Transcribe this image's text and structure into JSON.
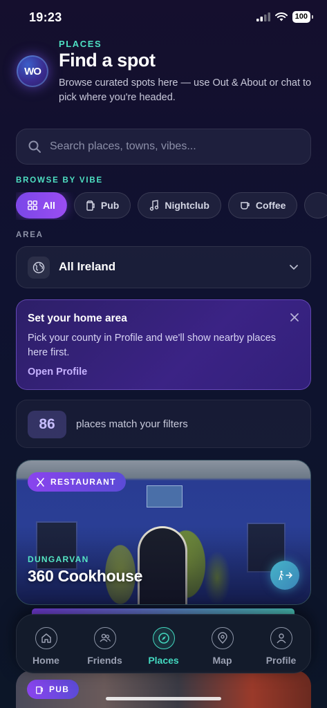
{
  "status_bar": {
    "time": "19:23",
    "battery": "100"
  },
  "header": {
    "logo_text": "WO",
    "eyebrow": "PLACES",
    "title": "Find a spot",
    "subtitle": "Browse curated spots here — use Out & About or chat to pick where you're headed."
  },
  "search": {
    "placeholder": "Search places, towns, vibes...",
    "icon": "search-icon"
  },
  "vibes": {
    "label": "BROWSE BY VIBE",
    "chips": [
      {
        "label": "All",
        "icon": "grid-icon",
        "active": true
      },
      {
        "label": "Pub",
        "icon": "beer-icon",
        "active": false
      },
      {
        "label": "Nightclub",
        "icon": "music-note-icon",
        "active": false
      },
      {
        "label": "Coffee",
        "icon": "coffee-cup-icon",
        "active": false
      }
    ]
  },
  "area": {
    "label": "AREA",
    "value": "All Ireland",
    "icon": "globe-icon"
  },
  "home_area_card": {
    "title": "Set your home area",
    "body": "Pick your county in Profile and we'll show nearby places here first.",
    "link": "Open Profile"
  },
  "results": {
    "count": "86",
    "text": "places match your filters"
  },
  "places": [
    {
      "type": "RESTAURANT",
      "type_icon": "utensils-icon",
      "area": "DUNGARVAN",
      "name": "360 Cookhouse"
    },
    {
      "type": "PUB",
      "type_icon": "beer-icon"
    }
  ],
  "tab_bar": {
    "tabs": [
      {
        "label": "Home",
        "icon": "home-icon",
        "active": false
      },
      {
        "label": "Friends",
        "icon": "friends-icon",
        "active": false
      },
      {
        "label": "Places",
        "icon": "compass-icon",
        "active": true
      },
      {
        "label": "Map",
        "icon": "map-pin-icon",
        "active": false
      },
      {
        "label": "Profile",
        "icon": "user-icon",
        "active": false
      }
    ]
  },
  "colors": {
    "accent_teal": "#43d9c0",
    "accent_purple": "#8a44ee",
    "background": "#131430"
  }
}
